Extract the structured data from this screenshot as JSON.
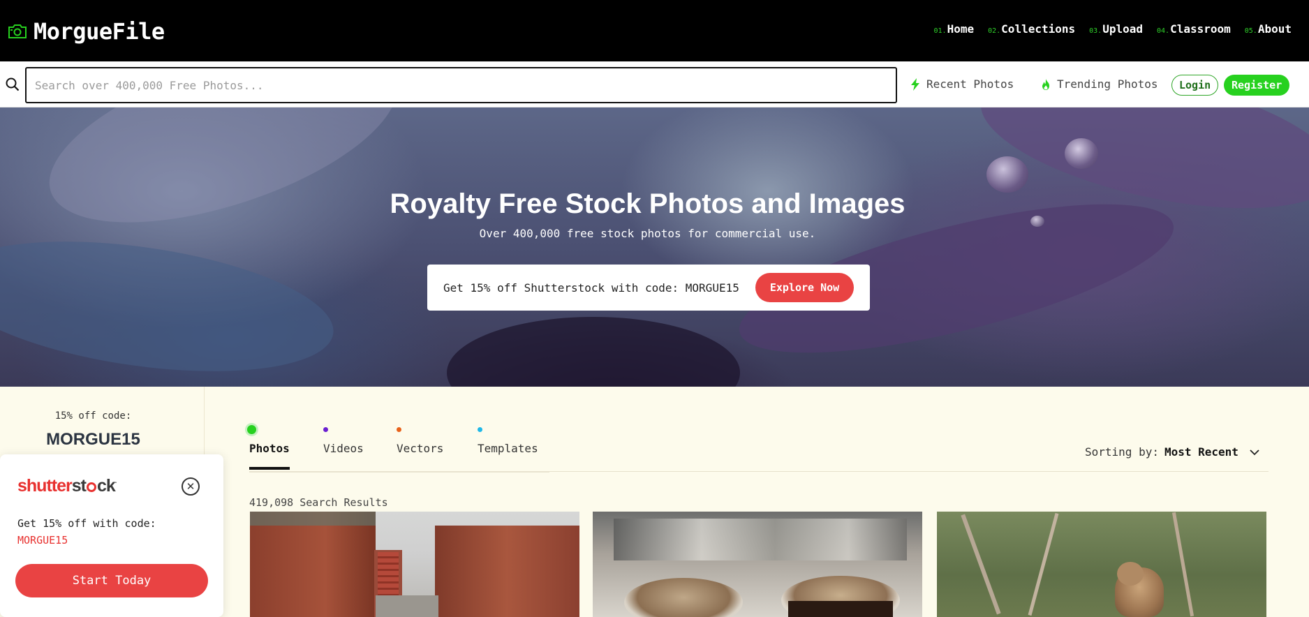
{
  "brand": {
    "name": "MorgueFile"
  },
  "nav": {
    "items": [
      {
        "num": "01.",
        "label": "Home"
      },
      {
        "num": "02.",
        "label": "Collections"
      },
      {
        "num": "03.",
        "label": "Upload"
      },
      {
        "num": "04.",
        "label": "Classroom"
      },
      {
        "num": "05.",
        "label": "About"
      }
    ]
  },
  "search": {
    "placeholder": "Search over 400,000 Free Photos...",
    "value": ""
  },
  "quicklinks": {
    "recent": "Recent Photos",
    "trending": "Trending Photos"
  },
  "auth": {
    "login": "Login",
    "register": "Register"
  },
  "hero": {
    "title": "Royalty Free Stock Photos and Images",
    "subtitle": "Over 400,000 free stock photos for commercial use.",
    "promo_text": "Get 15% off Shutterstock with code: MORGUE15",
    "promo_button": "Explore Now"
  },
  "sidebar": {
    "code_label": "15% off code:",
    "code_value": "MORGUE15"
  },
  "popup": {
    "logo_red": "shutter",
    "logo_dark": "st",
    "logo_red2": "ck",
    "text": "Get 15% off with code:",
    "code": "MORGUE15",
    "button": "Start Today"
  },
  "tabs": [
    {
      "label": "Photos",
      "dot_color": "#27d11f",
      "active": true
    },
    {
      "label": "Videos",
      "dot_color": "#6a1fd1",
      "active": false
    },
    {
      "label": "Vectors",
      "dot_color": "#e8621b",
      "active": false
    },
    {
      "label": "Templates",
      "dot_color": "#1fb8e8",
      "active": false
    }
  ],
  "sorting": {
    "label": "Sorting by:",
    "value": "Most Recent"
  },
  "results": {
    "count_text": "419,098 Search Results"
  },
  "colors": {
    "accent_green": "#27d11f",
    "accent_red": "#e94343",
    "background": "#fdfbec"
  }
}
